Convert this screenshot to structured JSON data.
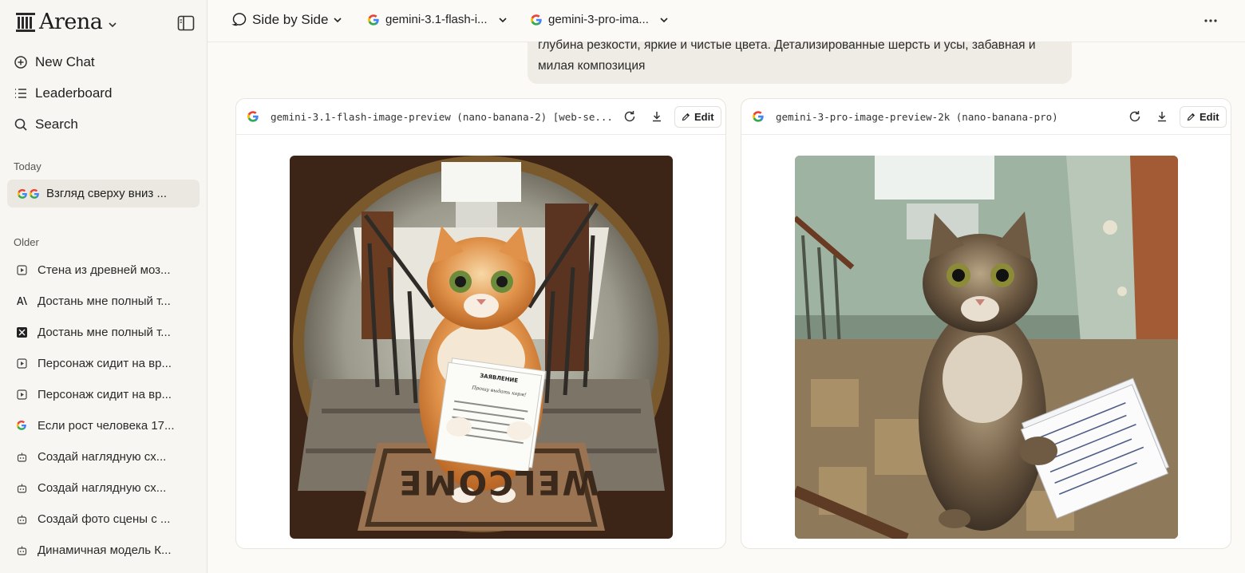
{
  "brand": {
    "name": "Arena"
  },
  "nav": {
    "new_chat": "New Chat",
    "leaderboard": "Leaderboard",
    "search": "Search"
  },
  "sections": {
    "today": "Today",
    "older": "Older"
  },
  "today_chats": [
    {
      "label": "Взгляд сверху вниз ...",
      "icon": "google-icon"
    }
  ],
  "older_chats": [
    {
      "label": "Стена из древней моз...",
      "icon": "image-icon"
    },
    {
      "label": "Достань мне полный т...",
      "icon": "anthropic-icon"
    },
    {
      "label": "Достань мне полный т...",
      "icon": "model-logo-icon"
    },
    {
      "label": "Персонаж сидит на вр...",
      "icon": "image-icon"
    },
    {
      "label": "Персонаж сидит на вр...",
      "icon": "image-icon"
    },
    {
      "label": "Если рост человека 17...",
      "icon": "google-icon"
    },
    {
      "label": "Создай наглядную сх...",
      "icon": "bot-icon"
    },
    {
      "label": "Создай наглядную сх...",
      "icon": "bot-icon"
    },
    {
      "label": "Создай фото сцены с ...",
      "icon": "bot-icon"
    },
    {
      "label": "Динамичная модель К...",
      "icon": "bot-icon"
    }
  ],
  "topbar": {
    "mode": "Side by Side",
    "model_a": "gemini-3.1-flash-i...",
    "model_b": "gemini-3-pro-ima..."
  },
  "prompt": {
    "line1": "глубина резкости, яркие и чистые цвета. Детализированные шерсть и усы, забавная и",
    "line2": "милая композиция"
  },
  "panels": [
    {
      "model": "gemini-3.1-flash-image-preview (nano-banana-2) [web-se...",
      "edit_label": "Edit",
      "image": {
        "description": "ginger cat holding papers in stairwell, fisheye",
        "doc_title": "ЗАЯВЛЕНИЕ",
        "doc_line": "Прошу выдать корм!",
        "mat_text": "WELCOME"
      }
    },
    {
      "model": "gemini-3-pro-image-preview-2k (nano-banana-pro)",
      "edit_label": "Edit",
      "image": {
        "description": "tabby cat holding handwritten papers in worn stairwell"
      }
    }
  ],
  "colors": {
    "accent": "#1f1f1f",
    "sidebar_bg": "#f7f6f2",
    "active_bg": "#ebe8e1",
    "bubble_bg": "#efece6"
  }
}
